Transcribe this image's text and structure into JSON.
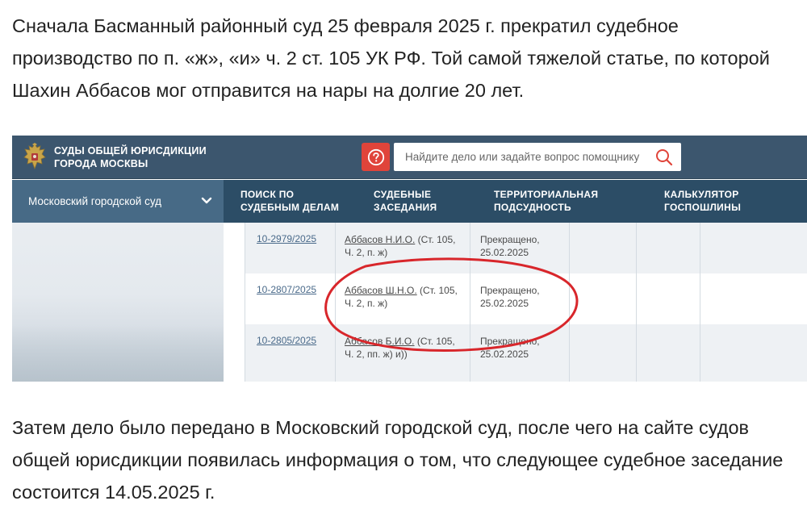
{
  "article": {
    "paragraph_before": "Сначала Басманный районный суд 25 февраля 2025 г. прекратил судебное производство по п. «ж», «и» ч. 2 ст. 105 УК РФ. Той самой тяжелой статье, по которой Шахин Аббасов мог отправится на нары на долгие 20 лет.",
    "paragraph_after": "Затем дело было передано в Московский городской суд, после чего на сайте судов общей юрисдикции появилась информация о том, что следующее судебное заседание состоится 14.05.2025 г."
  },
  "screenshot": {
    "header": {
      "org_name": "СУДЫ ОБЩЕЙ ЮРИСДИКЦИИ\nГОРОДА МОСКВЫ",
      "help_icon": "question-circle-icon",
      "search_placeholder": "Найдите дело или задайте вопрос помощнику",
      "search_icon": "magnifier-icon"
    },
    "nav": {
      "court_selected": "Московский городской суд",
      "items": [
        "ПОИСК ПО\nСУДЕБНЫМ ДЕЛАМ",
        "СУДЕБНЫЕ\nЗАСЕДАНИЯ",
        "ТЕРРИТОРИАЛЬНАЯ\nПОДСУДНОСТЬ",
        "КАЛЬКУЛЯТОР\nГОСПОШЛИНЫ"
      ]
    },
    "cases": [
      {
        "number": "10-2979/2025",
        "party": "Аббасов Н.И.О.",
        "article": "(Ст. 105, Ч. 2, п. ж)",
        "status": "Прекращено,\n25.02.2025"
      },
      {
        "number": "10-2807/2025",
        "party": "Аббасов Ш.Н.О.",
        "article": "(Ст. 105, Ч. 2, п. ж)",
        "status": "Прекращено,\n25.02.2025"
      },
      {
        "number": "10-2805/2025",
        "party": "Аббасов Б.И.О.",
        "article": "(Ст. 105, Ч. 2, пп. ж) и))",
        "status": "Прекращено,\n25.02.2025"
      }
    ],
    "colors": {
      "header_bg": "#3c566e",
      "nav_bg": "#2c4d66",
      "court_select_bg": "#476a86",
      "help_button": "#e0443a",
      "highlight_ellipse": "#d8262b"
    }
  }
}
